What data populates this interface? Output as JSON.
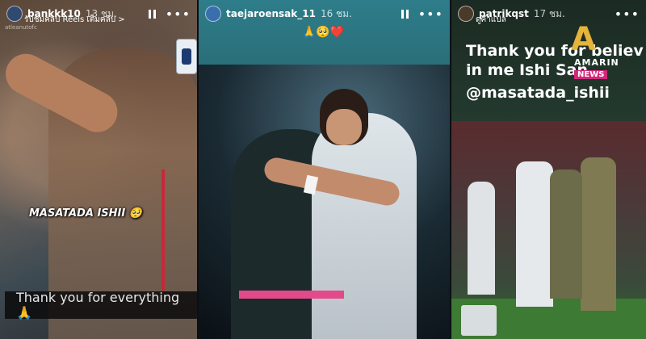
{
  "stories": [
    {
      "username": "bankkk10",
      "time": "13 ชม.",
      "subline": "รับชมคลิป Reels เต็มคลิป >",
      "tagline": "atleanutofc",
      "headline": "MASATADA ISHII 🥺",
      "caption": "Thank you for everything 🙏",
      "controls": [
        "pause-icon",
        "more-icon"
      ]
    },
    {
      "username": "taejaroensak_11",
      "time": "16 ชม.",
      "emojis": "🙏🥺❤️",
      "controls": [
        "pause-icon",
        "more-icon"
      ]
    },
    {
      "username": "patrikqst",
      "time": "17 ชม.",
      "subline": "ดูคำแปล",
      "message": "Thank you for believing in me Ishi San",
      "message_line1": "Thank you for believ",
      "message_line2": "in me Ishi San",
      "mention": "@masatada_ishii",
      "brand_logo": "AMARIN",
      "brand_badge": "NEWS",
      "brand_color": "#d2287a",
      "controls": [
        "more-icon"
      ]
    }
  ]
}
